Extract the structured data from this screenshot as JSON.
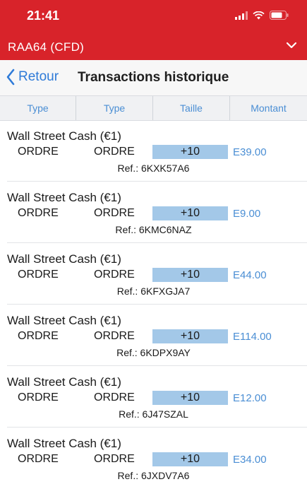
{
  "status_bar": {
    "time": "21:41",
    "icons": [
      "signal-icon",
      "wifi-icon",
      "battery-icon"
    ]
  },
  "header": {
    "title": "RAA64 (CFD)",
    "icon": "chevron-down-icon"
  },
  "nav": {
    "back_label": "Retour",
    "page_title": "Transactions historique"
  },
  "columns": [
    "Type",
    "Type",
    "Taille",
    "Montant"
  ],
  "transactions": [
    {
      "name": "Wall Street Cash (€1)",
      "type1": "ORDRE",
      "type2": "ORDRE",
      "size": "+10",
      "amount": "E39.00",
      "ref": "Ref.: 6KXK57A6"
    },
    {
      "name": "Wall Street Cash (€1)",
      "type1": "ORDRE",
      "type2": "ORDRE",
      "size": "+10",
      "amount": "E9.00",
      "ref": "Ref.: 6KMC6NAZ"
    },
    {
      "name": "Wall Street Cash (€1)",
      "type1": "ORDRE",
      "type2": "ORDRE",
      "size": "+10",
      "amount": "E44.00",
      "ref": "Ref.: 6KFXGJA7"
    },
    {
      "name": "Wall Street Cash (€1)",
      "type1": "ORDRE",
      "type2": "ORDRE",
      "size": "+10",
      "amount": "E114.00",
      "ref": "Ref.: 6KDPX9AY"
    },
    {
      "name": "Wall Street Cash (€1)",
      "type1": "ORDRE",
      "type2": "ORDRE",
      "size": "+10",
      "amount": "E12.00",
      "ref": "Ref.: 6J47SZAL"
    },
    {
      "name": "Wall Street Cash (€1)",
      "type1": "ORDRE",
      "type2": "ORDRE",
      "size": "+10",
      "amount": "E34.00",
      "ref": "Ref.: 6JXDV7A6"
    }
  ],
  "colors": {
    "brand_red": "#d8232a",
    "link_blue": "#2f7bd8",
    "size_fill": "#a3c8e8",
    "amount_blue": "#4a8ed4"
  }
}
